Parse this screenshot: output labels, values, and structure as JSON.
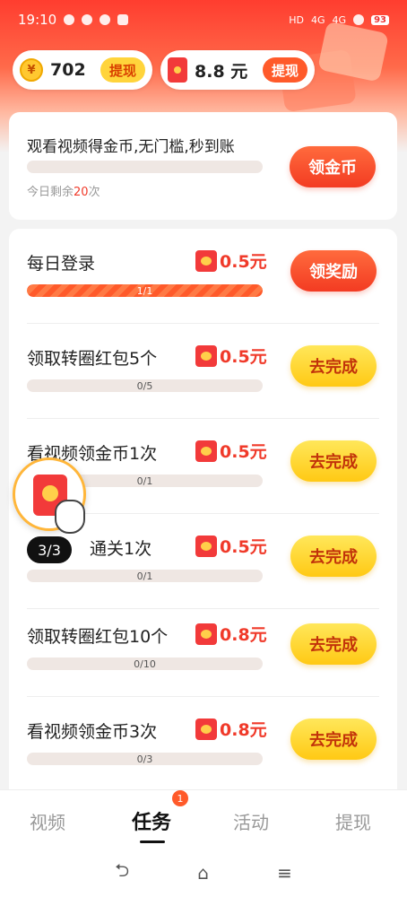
{
  "status_bar": {
    "time": "19:10",
    "battery": "93",
    "network_1": "4G",
    "network_2": "4G",
    "hd": "HD"
  },
  "wallet": {
    "coins": {
      "icon": "yen-coin-icon",
      "symbol": "¥",
      "value": "702",
      "button": "提现"
    },
    "cash": {
      "icon": "red-packet-icon",
      "value": "8.8 元",
      "button": "提现"
    }
  },
  "watch_card": {
    "title": "观看视频得金币,无门槛,秒到账",
    "progress": 0,
    "remaining_prefix": "今日剩余",
    "remaining_count": "20",
    "remaining_suffix": "次",
    "button": "领金币"
  },
  "tasks": [
    {
      "name": "每日登录",
      "reward": "0.5元",
      "progress_text": "1/1",
      "progress": 1.0,
      "button": "领奖励",
      "done": true
    },
    {
      "name": "领取转圈红包5个",
      "reward": "0.5元",
      "progress_text": "0/5",
      "progress": 0,
      "button": "去完成",
      "done": false
    },
    {
      "name": "看视频领金币1次",
      "reward": "0.5元",
      "progress_text": "0/1",
      "progress": 0,
      "button": "去完成",
      "done": false
    },
    {
      "name": "通关1次",
      "reward": "0.5元",
      "progress_text": "0/1",
      "progress": 0,
      "button": "去完成",
      "done": false
    },
    {
      "name": "领取转圈红包10个",
      "reward": "0.8元",
      "progress_text": "0/10",
      "progress": 0,
      "button": "去完成",
      "done": false
    },
    {
      "name": "看视频领金币3次",
      "reward": "0.8元",
      "progress_text": "0/3",
      "progress": 0,
      "button": "去完成",
      "done": false
    }
  ],
  "floating_widget": {
    "icon": "red-packet-pointer-icon",
    "badge": "3/3"
  },
  "tabs": [
    {
      "label": "视频",
      "active": false
    },
    {
      "label": "任务",
      "active": true,
      "badge": "1"
    },
    {
      "label": "活动",
      "active": false
    },
    {
      "label": "提现",
      "active": false
    }
  ],
  "nav": {
    "back": "⮌",
    "home": "⌂",
    "menu": "≡"
  },
  "colors": {
    "accent_red": "#f03a2a",
    "accent_yellow": "#ffc914",
    "header_red": "#ff3d2f"
  }
}
